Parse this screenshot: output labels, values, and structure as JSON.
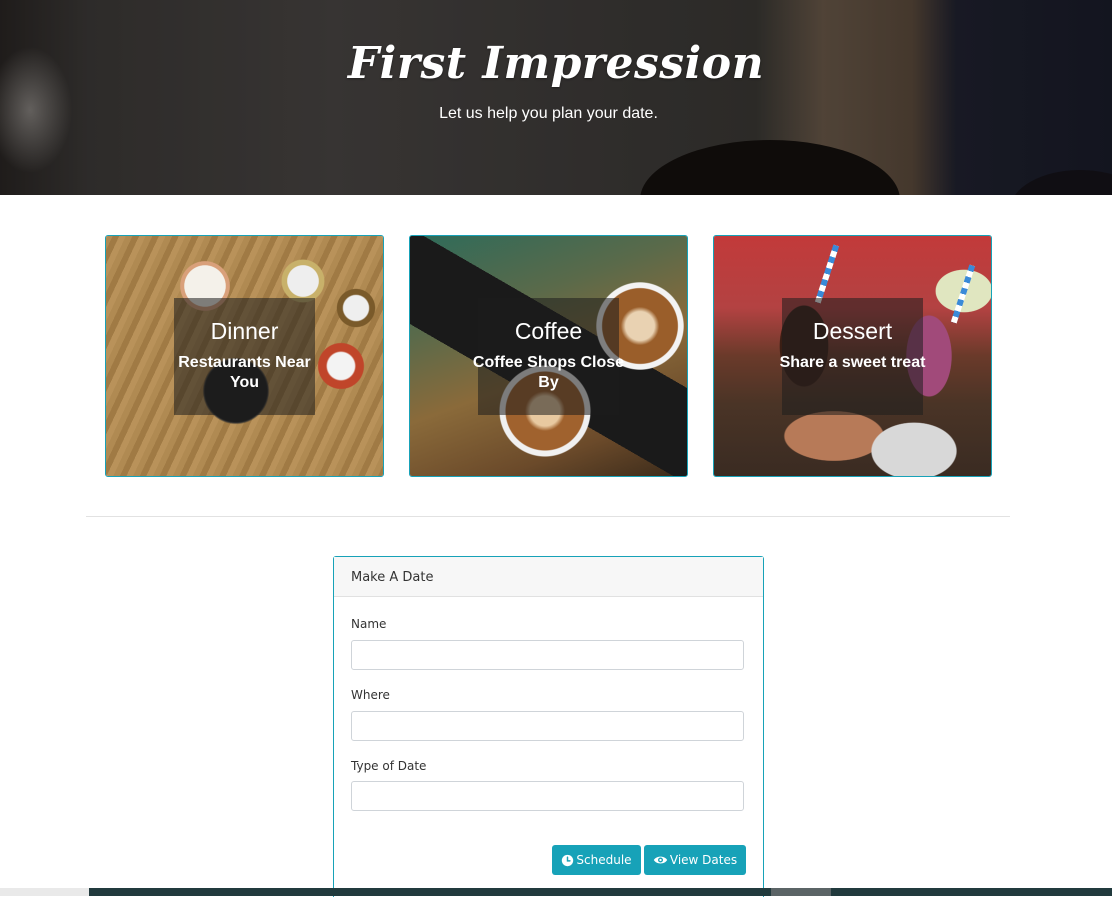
{
  "hero": {
    "title": "First Impression",
    "subtitle": "Let us help you plan your date."
  },
  "cards": [
    {
      "title": "Dinner",
      "subtitle": "Restaurants Near You"
    },
    {
      "title": "Coffee",
      "subtitle": "Coffee Shops Close By"
    },
    {
      "title": "Dessert",
      "subtitle": "Share a sweet treat"
    }
  ],
  "form": {
    "header": "Make A Date",
    "fields": [
      {
        "label": "Name",
        "value": ""
      },
      {
        "label": "Where",
        "value": ""
      },
      {
        "label": "Type of Date",
        "value": ""
      }
    ],
    "buttons": {
      "schedule": {
        "label": "Schedule",
        "icon": "clock-icon"
      },
      "view": {
        "label": "View Dates",
        "icon": "eye-icon"
      }
    }
  },
  "colors": {
    "accent": "#17a2b8",
    "header_bg": "#f7f7f7",
    "bottom_bar": "#213a3d"
  }
}
